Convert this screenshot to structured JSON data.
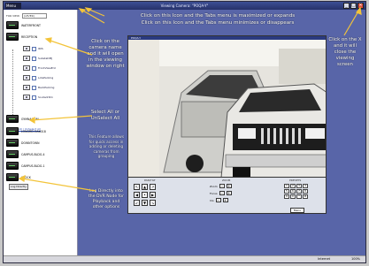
{
  "titlebar": {
    "left_label": "Menu",
    "title": "Viewing Camera: \"POQA-Y\""
  },
  "sidebar": {
    "filter_label": "FOR VIEW",
    "filter_value": "(LEVER)",
    "nodes": [
      {
        "label": "WATERFRONT"
      },
      {
        "label": "RECEPTION"
      },
      {
        "label": "GYMNASIUM"
      },
      {
        "label": "LONGRD-OAK018"
      },
      {
        "label": "DOWNTOWN"
      },
      {
        "label": "CAMPUS-BLDG-4"
      },
      {
        "label": "CAMPUS-BLDG-1"
      },
      {
        "label": "STOCK"
      }
    ],
    "cameras": [
      {
        "label": "IRIS"
      },
      {
        "label": "SubstaDMJ"
      },
      {
        "label": "FrontVlewEnt"
      },
      {
        "label": "LotsParking"
      },
      {
        "label": "BackParking"
      },
      {
        "label": "SoutadrRm"
      }
    ],
    "select_all": "Select All / UnSelect All",
    "log_button": "Log Directly"
  },
  "viewer": {
    "title": "POQA-Y"
  },
  "controls": {
    "ptz_title": "PAN/TILT",
    "zoom_title": "ZOOM",
    "preset_title": "PRESETS",
    "zoom_rows": [
      "Zoom",
      "Focus",
      "Iris"
    ],
    "menu_button": "Menu"
  },
  "annotations": {
    "top_icon_max": "Click on this Icon and the Tabs menu is maximized or expands",
    "top_icon_min": "Click on this Icon and the Tabs menu minimizes or disappears",
    "camera_name": "Click on the camera name and it will open in the viewing window on right",
    "close_x": "Click on the X and it will close the viewing screen",
    "select_all": "Select All or UnSelect All",
    "feature_info": "This Feature allows for quick access in adding or deleting cameras from grouping",
    "log_directly": "Log Directly into the DVR Node for Playback and other options"
  },
  "statusbar": {
    "internet": "Internet",
    "zoom": "100%"
  }
}
